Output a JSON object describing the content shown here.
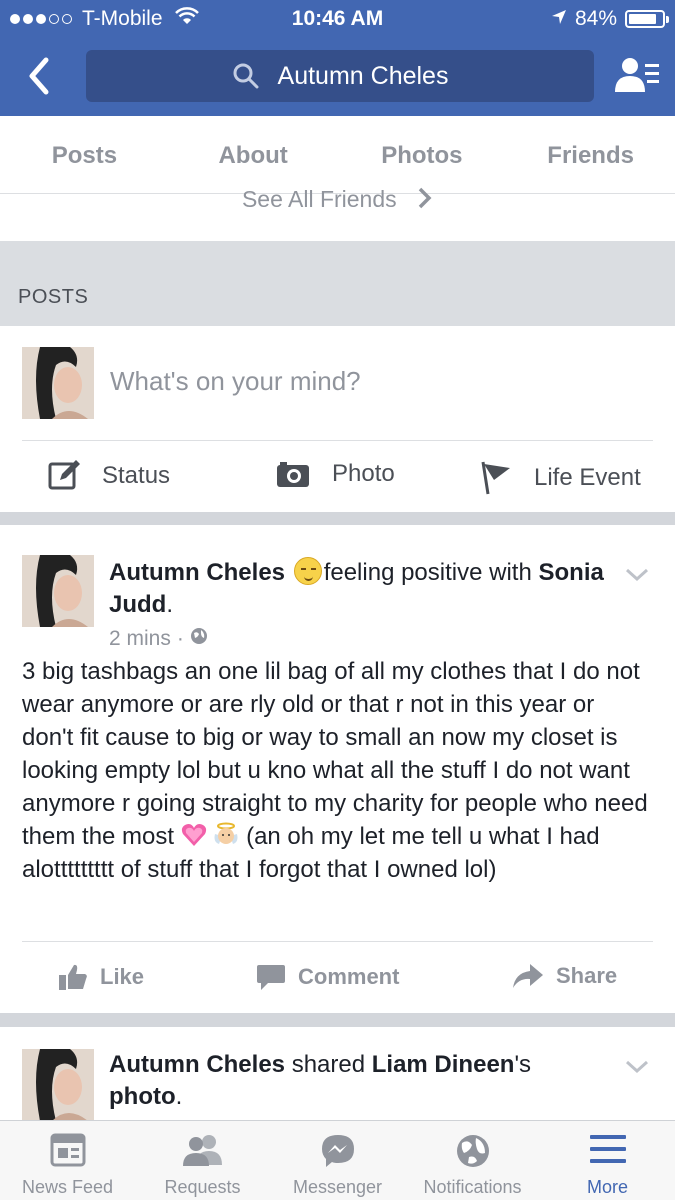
{
  "status_bar": {
    "carrier": "T-Mobile",
    "time": "10:46 AM",
    "battery_percent": "84%",
    "battery_level": 0.84
  },
  "header": {
    "search_text": "Autumn Cheles",
    "colors": {
      "brand": "#4267b2",
      "search_bg": "#354f8a"
    }
  },
  "tabs": [
    {
      "label": "Posts"
    },
    {
      "label": "About"
    },
    {
      "label": "Photos"
    },
    {
      "label": "Friends"
    }
  ],
  "friends_section": {
    "see_all_label": "See All Friends"
  },
  "posts_section": {
    "title": "POSTS"
  },
  "composer": {
    "placeholder": "What's on your mind?",
    "actions": [
      {
        "label": "Status",
        "icon": "pencil-icon"
      },
      {
        "label": "Photo",
        "icon": "camera-icon"
      },
      {
        "label": "Life Event",
        "icon": "flag-icon"
      }
    ]
  },
  "posts": [
    {
      "author": "Autumn Cheles",
      "feeling": "feeling positive with",
      "tagged": "Sonia Judd",
      "time": "2 mins",
      "body_main": "3 big tashbags an one lil bag of all my clothes that I do not wear anymore or are rly old or that r not in this year or don't fit cause to big or way to small an now my closet is looking empty lol but u kno what all the stuff I do not want anymore r going straight to my charity for people who need them the most",
      "body_tail": "(an oh my let me tell u what I had alottttttttt of stuff that I forgot that I owned lol)",
      "actions": {
        "like": "Like",
        "comment": "Comment",
        "share": "Share"
      }
    },
    {
      "author": "Autumn Cheles",
      "verb": "shared",
      "shared_from": "Liam Dineen",
      "shared_suffix": "'s",
      "shared_object": "photo"
    }
  ],
  "bottom_nav": [
    {
      "label": "News Feed",
      "icon": "news-feed-icon"
    },
    {
      "label": "Requests",
      "icon": "requests-icon"
    },
    {
      "label": "Messenger",
      "icon": "messenger-icon"
    },
    {
      "label": "Notifications",
      "icon": "globe-icon"
    },
    {
      "label": "More",
      "icon": "menu-icon",
      "active": true
    }
  ]
}
